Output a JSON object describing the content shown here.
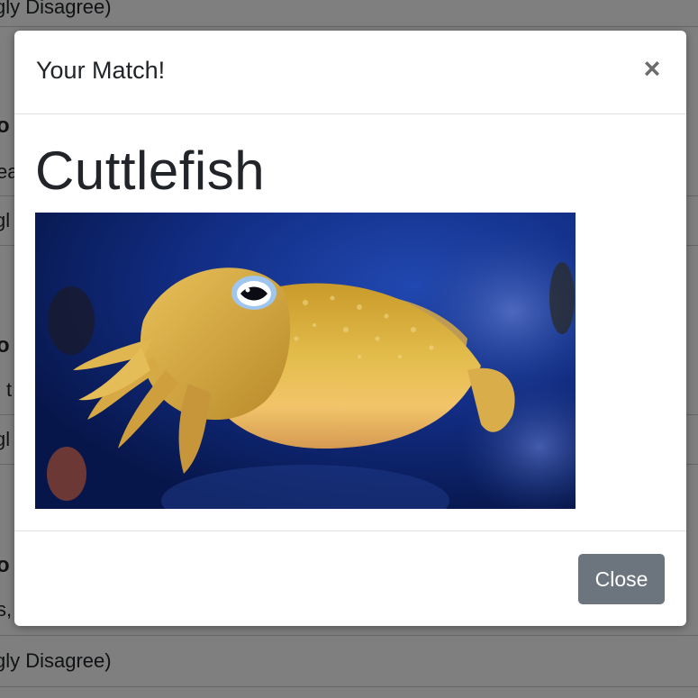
{
  "background": {
    "rows": [
      {
        "text": "gly Disagree)"
      },
      {
        "text": "gl"
      },
      {
        "text": "gl"
      },
      {
        "text": "gly Disagree)"
      }
    ],
    "fragments": [
      "o",
      "ea",
      "o",
      "l t",
      "o",
      "s,"
    ]
  },
  "modal": {
    "title": "Your Match!",
    "close_icon": "×",
    "body": {
      "heading": "Cuttlefish",
      "image_alt_subject": "cuttlefish photo"
    },
    "footer": {
      "close_label": "Close"
    }
  },
  "colors": {
    "button_secondary": "#6c757d",
    "backdrop": "rgba(0,0,0,0.5)",
    "photo_background": "#10287a"
  }
}
